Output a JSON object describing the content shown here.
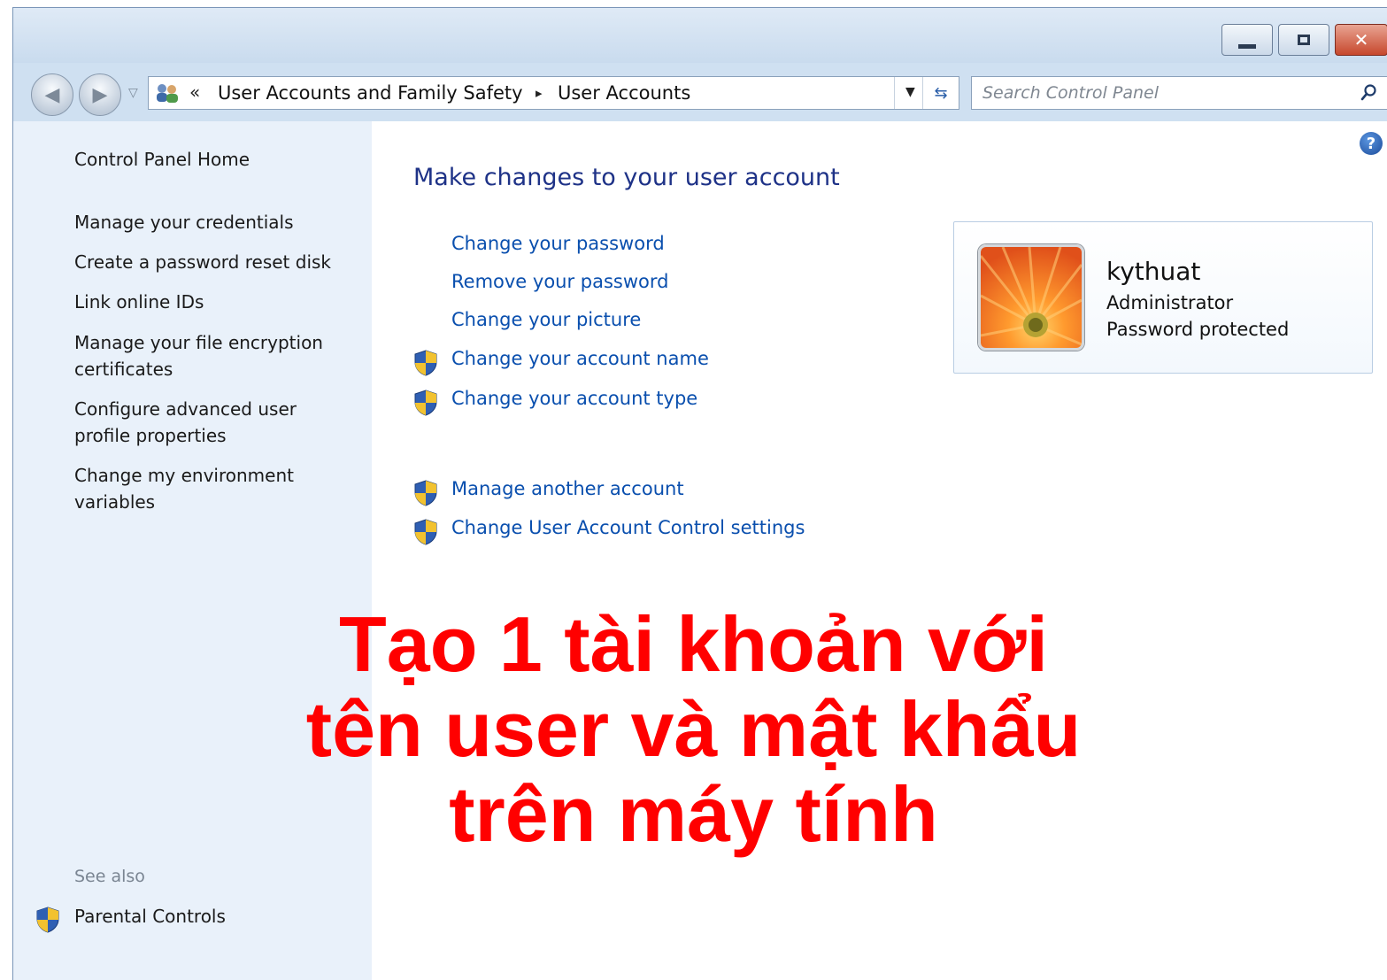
{
  "window": {
    "caption_buttons": {
      "minimize_icon": "minimize-icon",
      "maximize_icon": "maximize-icon",
      "close_icon": "close-icon"
    }
  },
  "addressbar": {
    "chevron": "«",
    "breadcrumbs": [
      {
        "label": "User Accounts and Family Safety"
      },
      {
        "label": "User Accounts"
      }
    ],
    "separator": "▸"
  },
  "search": {
    "placeholder": "Search Control Panel"
  },
  "sidebar": {
    "home": "Control Panel Home",
    "links": [
      {
        "label": "Manage your credentials"
      },
      {
        "label": "Create a password reset disk"
      },
      {
        "label": "Link online IDs"
      },
      {
        "label": "Manage your file encryption certificates"
      },
      {
        "label": "Configure advanced user profile properties"
      },
      {
        "label": "Change my environment variables"
      }
    ],
    "see_also": "See also",
    "parental_controls": "Parental Controls"
  },
  "main": {
    "title": "Make changes to your user account",
    "tasks": [
      {
        "label": "Change your password",
        "shield": false
      },
      {
        "label": "Remove your password",
        "shield": false
      },
      {
        "label": "Change your picture",
        "shield": false
      },
      {
        "label": "Change your account name",
        "shield": true
      },
      {
        "label": "Change your account type",
        "shield": true
      }
    ],
    "other_tasks": [
      {
        "label": "Manage another account",
        "shield": true
      },
      {
        "label": "Change User Account Control settings",
        "shield": true
      }
    ]
  },
  "user": {
    "name": "kythuat",
    "role": "Administrator",
    "status": "Password protected"
  },
  "overlay": {
    "lines": [
      "Tạo 1 tài khoản với",
      "tên user và mật khẩu",
      "trên máy tính"
    ],
    "color": "#ff0000"
  },
  "colors": {
    "link": "#0a4fae",
    "title": "#1e3287",
    "sidebar_bg": "#e9f1fa"
  }
}
